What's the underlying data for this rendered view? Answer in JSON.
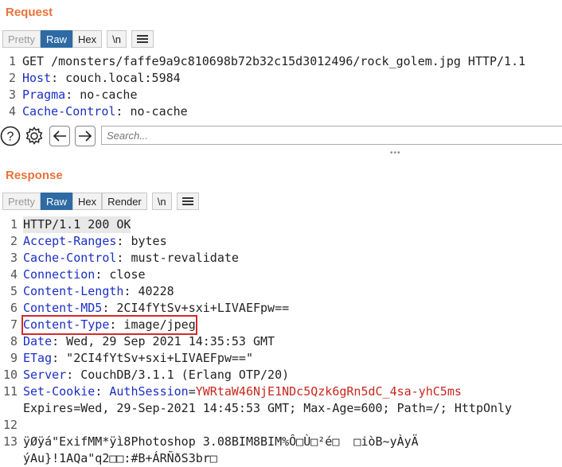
{
  "request": {
    "title": "Request",
    "tabs": [
      "Pretty",
      "Raw",
      "Hex",
      "\\n"
    ],
    "lines": [
      {
        "n": "1",
        "parts": [
          {
            "t": "GET /monsters/faffe9a9c810698b72b32c15d3012496/rock_golem.jpg HTTP/1.1",
            "c": "txt"
          }
        ]
      },
      {
        "n": "2",
        "parts": [
          {
            "t": "Host",
            "c": "key"
          },
          {
            "t": ": couch.local:5984",
            "c": "val"
          }
        ]
      },
      {
        "n": "3",
        "parts": [
          {
            "t": "Pragma",
            "c": "key"
          },
          {
            "t": ": no-cache",
            "c": "val"
          }
        ]
      },
      {
        "n": "4",
        "parts": [
          {
            "t": "Cache-Control",
            "c": "key"
          },
          {
            "t": ": no-cache",
            "c": "val"
          }
        ]
      }
    ],
    "search_placeholder": "Search..."
  },
  "response": {
    "title": "Response",
    "tabs": [
      "Pretty",
      "Raw",
      "Hex",
      "Render",
      "\\n"
    ],
    "lines": [
      {
        "n": "1",
        "parts": [
          {
            "t": "HTTP/1.1 200 OK",
            "c": "txt"
          }
        ],
        "hl": true
      },
      {
        "n": "2",
        "parts": [
          {
            "t": "Accept-Ranges",
            "c": "key"
          },
          {
            "t": ": bytes",
            "c": "val"
          }
        ]
      },
      {
        "n": "3",
        "parts": [
          {
            "t": "Cache-Control",
            "c": "key"
          },
          {
            "t": ": must-revalidate",
            "c": "val"
          }
        ]
      },
      {
        "n": "4",
        "parts": [
          {
            "t": "Connection",
            "c": "key"
          },
          {
            "t": ": close",
            "c": "val"
          }
        ]
      },
      {
        "n": "5",
        "parts": [
          {
            "t": "Content-Length",
            "c": "key"
          },
          {
            "t": ": 40228",
            "c": "val"
          }
        ]
      },
      {
        "n": "6",
        "parts": [
          {
            "t": "Content-MD5",
            "c": "key"
          },
          {
            "t": ": 2CI4fYtSv+sxi+LIVAEFpw==",
            "c": "val"
          }
        ]
      },
      {
        "n": "7",
        "parts": [
          {
            "t": "Content-Type",
            "c": "key"
          },
          {
            "t": ": image/jpeg",
            "c": "val"
          }
        ],
        "boxed": true
      },
      {
        "n": "8",
        "parts": [
          {
            "t": "Date",
            "c": "key"
          },
          {
            "t": ": Wed, 29 Sep 2021 14:35:53 GMT",
            "c": "val"
          }
        ]
      },
      {
        "n": "9",
        "parts": [
          {
            "t": "ETag",
            "c": "key"
          },
          {
            "t": ": \"2CI4fYtSv+sxi+LIVAEFpw==\"",
            "c": "val"
          }
        ]
      },
      {
        "n": "10",
        "parts": [
          {
            "t": "Server",
            "c": "key"
          },
          {
            "t": ": CouchDB/3.1.1 (Erlang OTP/20)",
            "c": "val"
          }
        ]
      },
      {
        "n": "11",
        "parts": [
          {
            "t": "Set-Cookie",
            "c": "key"
          },
          {
            "t": ": ",
            "c": "val"
          },
          {
            "t": "AuthSession",
            "c": "key"
          },
          {
            "t": "=",
            "c": "val"
          },
          {
            "t": "YWRtaW46NjE1NDc5Qzk6gRn5dC_4sa-yhC5ms",
            "c": "red"
          }
        ]
      },
      {
        "n": "",
        "parts": [
          {
            "t": "Expires=Wed, 29-Sep-2021 14:45:53 GMT; Max-Age=600; Path=/; HttpOnly",
            "c": "val"
          }
        ]
      },
      {
        "n": "12",
        "parts": []
      },
      {
        "n": "13",
        "parts": [
          {
            "t": "ÿØÿá\"ExifMM*ÿì8Photoshop 3.08BIM8BIM%Ô□Ù□²é□  □iòB~yÀyÄ",
            "c": "val"
          }
        ]
      },
      {
        "n": "",
        "parts": [
          {
            "t": "ýAu}!1AQa\"q2□□:#B+ÁRÑðS3br□",
            "c": "val"
          }
        ]
      }
    ]
  }
}
